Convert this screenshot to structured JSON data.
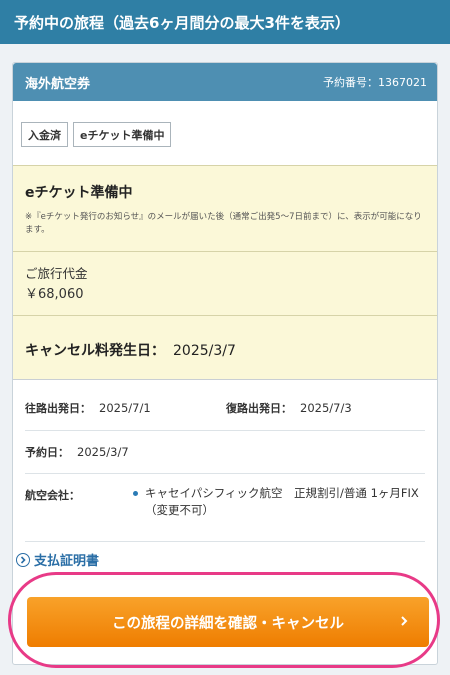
{
  "header": {
    "title": "予約中の旅程（過去6ヶ月間分の最大3件を表示）"
  },
  "card": {
    "title": "海外航空券",
    "reservation_label": "予約番号：1367021",
    "tags": [
      "入金済",
      "eチケット準備中"
    ],
    "status": {
      "title": "eチケット準備中",
      "note": "※『eチケット発行のお知らせ』のメールが届いた後（通常ご出発5～7日前まで）に、表示が可能になります。"
    },
    "fee": {
      "label": "ご旅行代金",
      "value": "￥68,060"
    },
    "cancellation": {
      "label": "キャンセル料発生日：",
      "date": "2025/3/7"
    },
    "details": {
      "outbound_label": "往路出発日：",
      "outbound_date": "2025/7/1",
      "return_label": "復路出発日：",
      "return_date": "2025/7/3",
      "booking_label": "予約日：",
      "booking_date": "2025/3/7",
      "airline_label": "航空会社：",
      "airline_value": "キャセイパシフィック航空　正規割引/普通 1ヶ月FIX（変更不可）"
    },
    "payment_link": "支払証明書",
    "cta_label": "この旅程の詳細を確認・キャンセル"
  },
  "colors": {
    "header": "#2f7fa5",
    "card_header": "#4e8fb2",
    "cta": "#f39200",
    "highlight": "#e83a87"
  }
}
